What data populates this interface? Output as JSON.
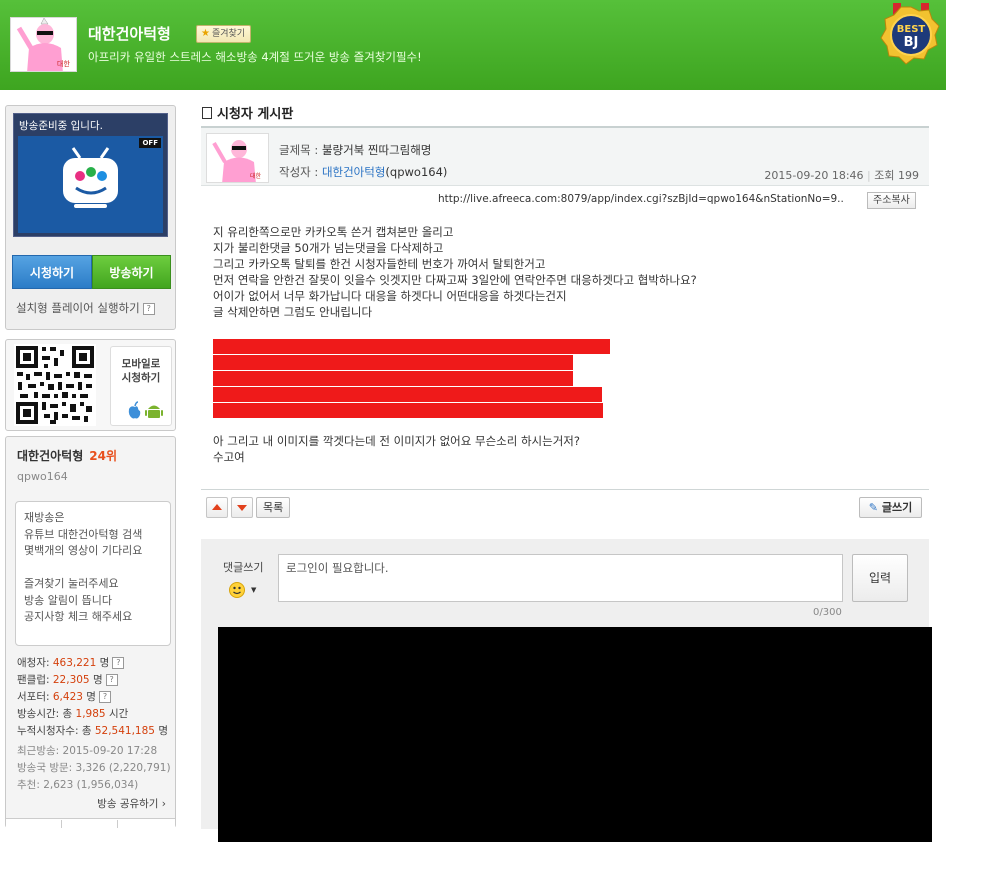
{
  "header": {
    "title": "대한건아턱형",
    "fav_label": "즐겨찾기",
    "description": "아프리카 유일한 스트레스 해소방송 4계절 뜨거운 방송 즐겨찾기필수!",
    "badge_line1": "BEST",
    "badge_line2": "BJ",
    "avatar_stamp": "대한"
  },
  "sidebar": {
    "broadcast_status": "방송준비중 입니다.",
    "off_tag": "OFF",
    "watch_button": "시청하기",
    "broadcast_button": "방송하기",
    "player_run": "설치형 플레이어 실행하기",
    "help": "?",
    "mobile_line1": "모바일로",
    "mobile_line2": "시청하기",
    "bj_name": "대한건아턱형",
    "bj_rank": "24위",
    "bj_id": "qpwo164",
    "notice_lines": [
      "재방송은",
      "유튜브 대한건아턱형 검색",
      "몇백개의 영상이 기다리요",
      "",
      "즐겨찾기 눌러주세요",
      "방송 알림이 뜹니다",
      "공지사항 체크 해주세요"
    ],
    "stats": {
      "fans_label": "애청자:",
      "fans_value": "463,221",
      "fans_unit": "명",
      "fanclub_label": "팬클럽:",
      "fanclub_value": "22,305",
      "fanclub_unit": "명",
      "supporter_label": "서포터:",
      "supporter_value": "6,423",
      "supporter_unit": "명",
      "time_label": "방송시간: 총",
      "time_value": "1,985",
      "time_unit": "시간",
      "viewers_label": "누적시청자수: 총",
      "viewers_value": "52,541,185",
      "viewers_unit": "명"
    },
    "recent_broadcast": "최근방송: 2015-09-20 17:28",
    "visits": "방송국 방문: 3,326 (2,220,791)",
    "recommend": "추천: 2,623 (1,956,034)",
    "share": "방송 공유하기 ›"
  },
  "board": {
    "title": "시청자 게시판",
    "subject_label": "글제목 :",
    "subject": "불량거북 찐따그림해명",
    "author_label": "작성자 :",
    "author": "대한건아턱형",
    "author_id": "(qpwo164)",
    "date": "2015-09-20 18:46",
    "views_label": "조회",
    "views": "199",
    "url": "http://live.afreeca.com:8079/app/index.cgi?szBjId=qpwo164&nStationNo=9..",
    "copy_button": "주소복사",
    "body_lines": [
      "지 유리한쪽으로만 카카오톡 쓴거 캡쳐본만 올리고",
      "지가 불리한댓글 50개가 넘는댓글을 다삭제하고",
      "그리고 카카오톡 탈퇴를 한건 시청자들한테 번호가 까여서 탈퇴한거고",
      "먼저 연락을 안한건 잘못이 잇을수 잇겟지만 다짜고짜 3일안에 연락안주면 대응하겟다고 협박하나요?",
      "어이가 없어서 너무 화가납니다 대응을 하겟다니 어떤대응을 하겟다는건지",
      "글 삭제안하면 그럼도 안내립니다"
    ],
    "body_lines2": [
      "아 그리고 내 이미지를 깍겟다는데 전 이미지가 없어요 무슨소리 하시는거저?",
      "수고여"
    ],
    "list_button": "목록",
    "write_button": "글쓰기"
  },
  "comment": {
    "label": "댓글쓰기",
    "placeholder": "로그인이 필요합니다.",
    "submit": "입력",
    "count": "0/300"
  },
  "colors": {
    "header_green": "#4cb52c",
    "redaction": "#ef1a1a",
    "link_blue": "#2b73c4",
    "stat_red": "#d4400c"
  }
}
